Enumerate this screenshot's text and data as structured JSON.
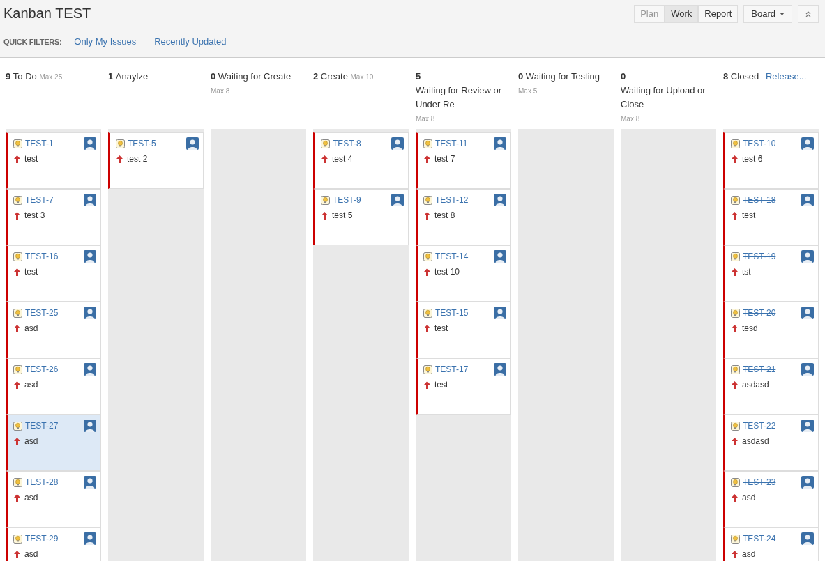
{
  "board": {
    "title": "Kanban TEST"
  },
  "quick_filters": {
    "label": "QUICK FILTERS:",
    "items": [
      "Only My Issues",
      "Recently Updated"
    ]
  },
  "view_buttons": [
    {
      "label": "Plan",
      "selected": false,
      "disabled": true
    },
    {
      "label": "Work",
      "selected": true,
      "disabled": false
    },
    {
      "label": "Report",
      "selected": false,
      "disabled": false
    }
  ],
  "board_menu": "Board",
  "columns": [
    {
      "count": "9",
      "name": "To Do",
      "max": "Max 25",
      "cards": [
        {
          "key": "TEST-1",
          "summary": "test",
          "done": false,
          "selected": false
        },
        {
          "key": "TEST-7",
          "summary": "test 3",
          "done": false,
          "selected": false
        },
        {
          "key": "TEST-16",
          "summary": "test",
          "done": false,
          "selected": false
        },
        {
          "key": "TEST-25",
          "summary": "asd",
          "done": false,
          "selected": false
        },
        {
          "key": "TEST-26",
          "summary": "asd",
          "done": false,
          "selected": false
        },
        {
          "key": "TEST-27",
          "summary": "asd",
          "done": false,
          "selected": true
        },
        {
          "key": "TEST-28",
          "summary": "asd",
          "done": false,
          "selected": false
        },
        {
          "key": "TEST-29",
          "summary": "asd",
          "done": false,
          "selected": false
        }
      ]
    },
    {
      "count": "1",
      "name": "Anaylze",
      "cards": [
        {
          "key": "TEST-5",
          "summary": "test 2",
          "done": false,
          "selected": false
        }
      ]
    },
    {
      "count": "0",
      "name": "Waiting for Create",
      "max": "Max 8"
    },
    {
      "count": "2",
      "name": "Create",
      "max": "Max 10",
      "cards": [
        {
          "key": "TEST-8",
          "summary": "test 4",
          "done": false,
          "selected": false
        },
        {
          "key": "TEST-9",
          "summary": "test 5",
          "done": false,
          "selected": false
        }
      ]
    },
    {
      "count": "5",
      "name": "Waiting for Review or Under Re",
      "max": "Max 8",
      "cards": [
        {
          "key": "TEST-11",
          "summary": "test 7",
          "done": false,
          "selected": false
        },
        {
          "key": "TEST-12",
          "summary": "test 8",
          "done": false,
          "selected": false
        },
        {
          "key": "TEST-14",
          "summary": "test 10",
          "done": false,
          "selected": false
        },
        {
          "key": "TEST-15",
          "summary": "test",
          "done": false,
          "selected": false
        },
        {
          "key": "TEST-17",
          "summary": "test",
          "done": false,
          "selected": false
        }
      ]
    },
    {
      "count": "0",
      "name": "Waiting for Testing",
      "max": "Max 5"
    },
    {
      "count": "0",
      "name": "Waiting for Upload or Close",
      "max": "Max 8"
    },
    {
      "count": "8",
      "name": "Closed",
      "link": "Release...",
      "cards": [
        {
          "key": "TEST-10",
          "summary": "test 6",
          "done": true,
          "selected": false
        },
        {
          "key": "TEST-18",
          "summary": "test",
          "done": true,
          "selected": false
        },
        {
          "key": "TEST-19",
          "summary": "tst",
          "done": true,
          "selected": false
        },
        {
          "key": "TEST-20",
          "summary": "tesd",
          "done": true,
          "selected": false
        },
        {
          "key": "TEST-21",
          "summary": "asdasd",
          "done": true,
          "selected": false
        },
        {
          "key": "TEST-22",
          "summary": "asdasd",
          "done": true,
          "selected": false
        },
        {
          "key": "TEST-23",
          "summary": "asd",
          "done": true,
          "selected": false
        },
        {
          "key": "TEST-24",
          "summary": "asd",
          "done": true,
          "selected": false
        }
      ]
    }
  ]
}
